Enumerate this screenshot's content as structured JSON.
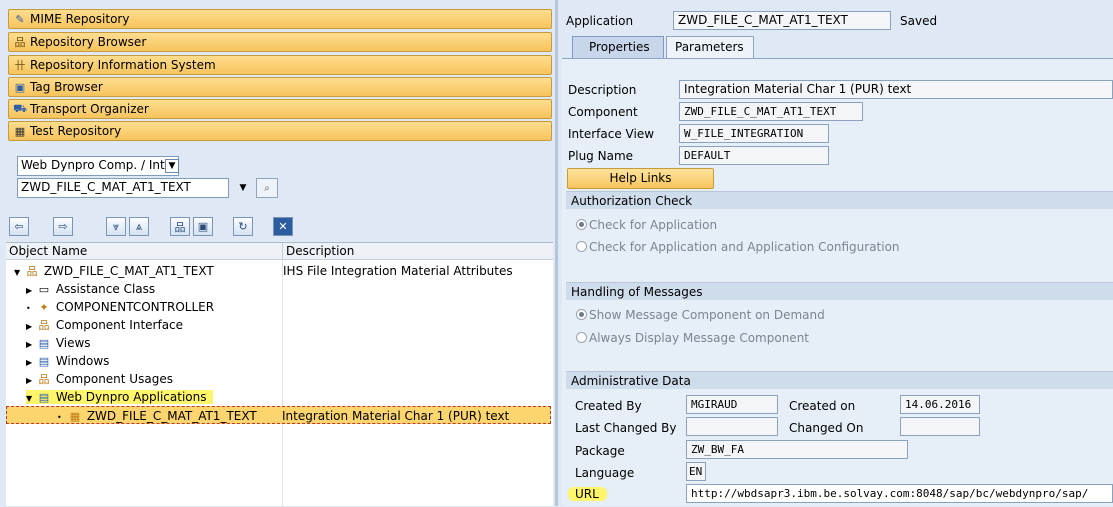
{
  "navigator": {
    "buttons": [
      {
        "label": "MIME Repository",
        "icon": "mime-icon"
      },
      {
        "label": "Repository Browser",
        "icon": "repository-icon"
      },
      {
        "label": "Repository Information System",
        "icon": "info-system-icon"
      },
      {
        "label": "Tag Browser",
        "icon": "tag-icon"
      },
      {
        "label": "Transport Organizer",
        "icon": "truck-icon"
      },
      {
        "label": "Test Repository",
        "icon": "test-icon"
      }
    ],
    "object_type": "Web Dynpro Comp. / Intf.",
    "object_name": "ZWD_FILE_C_MAT_AT1_TEXT"
  },
  "tree": {
    "headers": {
      "name": "Object Name",
      "description": "Description"
    },
    "rows": [
      {
        "name": "ZWD_FILE_C_MAT_AT1_TEXT",
        "description": "IHS File Integration Material Attributes"
      },
      {
        "name": "Assistance Class",
        "description": ""
      },
      {
        "name": "COMPONENTCONTROLLER",
        "description": ""
      },
      {
        "name": "Component Interface",
        "description": ""
      },
      {
        "name": "Views",
        "description": ""
      },
      {
        "name": "Windows",
        "description": ""
      },
      {
        "name": "Component Usages",
        "description": ""
      },
      {
        "name": "Web Dynpro Applications",
        "description": ""
      },
      {
        "name": "ZWD_FILE_C_MAT_AT1_TEXT",
        "description": "Integration Material Char 1 (PUR) text"
      }
    ]
  },
  "detail": {
    "application_label": "Application",
    "application_value": "ZWD_FILE_C_MAT_AT1_TEXT",
    "status": "Saved",
    "tabs": [
      "Properties",
      "Parameters"
    ],
    "description_label": "Description",
    "description_value": "Integration Material Char 1 (PUR) text",
    "component_label": "Component",
    "component_value": "ZWD_FILE_C_MAT_AT1_TEXT",
    "interface_view_label": "Interface View",
    "interface_view_value": "W_FILE_INTEGRATION",
    "plug_name_label": "Plug Name",
    "plug_name_value": "DEFAULT",
    "help_links_label": "Help Links",
    "auth_check": {
      "title": "Authorization Check",
      "options": [
        "Check for Application",
        "Check for Application and Application Configuration"
      ]
    },
    "messages": {
      "title": "Handling of Messages",
      "options": [
        "Show Message Component on Demand",
        "Always Display Message Component"
      ]
    },
    "admin": {
      "title": "Administrative Data",
      "created_by_label": "Created By",
      "created_by_value": "MGIRAUD",
      "created_on_label": "Created on",
      "created_on_value": "14.06.2016",
      "last_changed_by_label": "Last Changed By",
      "last_changed_by_value": "",
      "changed_on_label": "Changed On",
      "changed_on_value": "",
      "package_label": "Package",
      "package_value": "ZW_BW_FA",
      "language_label": "Language",
      "language_value": "EN",
      "url_label": "URL",
      "url_value": "http://wbdsapr3.ibm.be.solvay.com:8048/sap/bc/webdynpro/sap/"
    }
  },
  "colors": {
    "accent_orange": "#f7c45d",
    "highlight_yellow": "#fff56a",
    "panel_blue": "#dfe9f5"
  }
}
